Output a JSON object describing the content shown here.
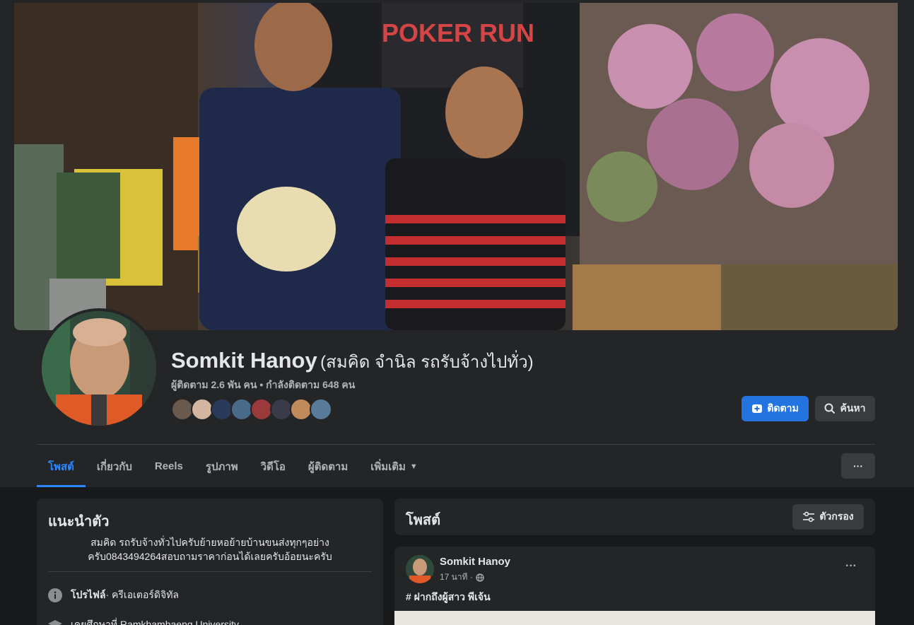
{
  "profile": {
    "name": "Somkit Hanoy",
    "alt_name": "(สมคิด จำนิล รถรับจ้างไปทั่ว)",
    "followers_line": "ผู้ติดตาม 2.6 พัน คน • กำลังติดตาม 648 คน",
    "friend_count_shown": 8
  },
  "actions": {
    "follow_label": "ติดตาม",
    "search_label": "ค้นหา",
    "more_label": "···"
  },
  "tabs": [
    {
      "label": "โพสต์"
    },
    {
      "label": "เกี่ยวกับ"
    },
    {
      "label": "Reels"
    },
    {
      "label": "รูปภาพ"
    },
    {
      "label": "วิดีโอ"
    },
    {
      "label": "ผู้ติดตาม"
    },
    {
      "label": "เพิ่มเติม"
    }
  ],
  "intro": {
    "title": "แนะนำตัว",
    "bio_line1": "สมคิด รถรับจ้างทั่วไปครับย้ายหอย้ายบ้านขนส่งทุกๆอย่าง",
    "bio_line2": "ครับ0843494264สอบถามราคาก่อนได้เลยครับอ้อยนะครับ",
    "profile_label": "โปรไฟล์",
    "profile_value": " · ครีเอเตอร์ดิจิทัล",
    "education": "เคยศึกษาที่ Ramkhamhaeng University"
  },
  "posts": {
    "title": "โพสต์",
    "filter_label": "ตัวกรอง",
    "first_post": {
      "author": "Somkit Hanoy",
      "time": "17 นาที ·",
      "text": "# ฝากถึงผู้สาว พีเจ้น"
    }
  },
  "colors": {
    "accent": "#2d88ff",
    "button_primary": "#2374e1",
    "surface": "#242526",
    "background": "#18191a"
  },
  "icons": {
    "follow": "add-follow-icon",
    "search": "search-icon",
    "more": "more-dots-icon",
    "info": "info-icon",
    "education": "graduation-cap-icon",
    "filter": "filter-sliders-icon",
    "globe": "globe-icon"
  }
}
